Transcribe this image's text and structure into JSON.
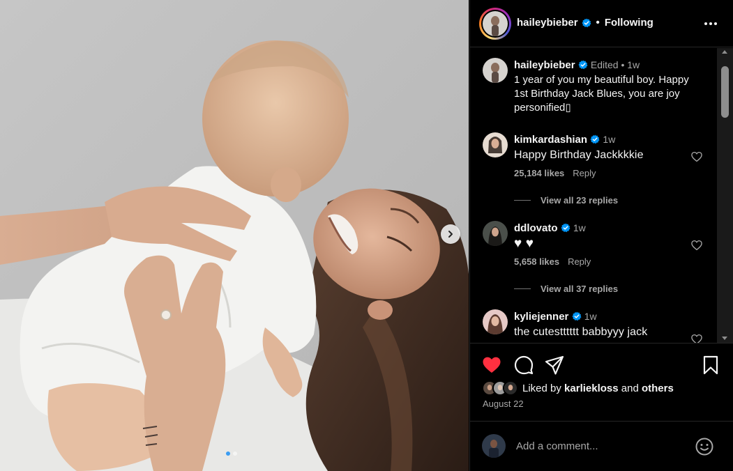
{
  "post": {
    "author": "haileybieber",
    "separator": "•",
    "follow_label": "Following",
    "more_label": "More options"
  },
  "caption": {
    "user": "haileybieber",
    "meta": "Edited •  1w",
    "text": "1 year of you my beautiful boy. Happy 1st Birthday Jack Blues, you are joy personified▯"
  },
  "comments": [
    {
      "user": "kimkardashian",
      "time": "1w",
      "text": "Happy Birthday Jackkkkie",
      "likes": "25,184 likes",
      "reply_label": "Reply",
      "view_replies": "View all 23 replies"
    },
    {
      "user": "ddlovato",
      "time": "1w",
      "text": "♥ ♥",
      "likes": "5,658 likes",
      "reply_label": "Reply",
      "view_replies": "View all 37 replies"
    },
    {
      "user": "kyliejenner",
      "time": "1w",
      "text": "the cutestttttt babbyyy jack"
    }
  ],
  "likes_summary": {
    "prefix": "Liked by",
    "user": "karliekloss",
    "conjunction": "and",
    "others": "others"
  },
  "date": "August 22",
  "composer": {
    "placeholder": "Add a comment..."
  },
  "carousel": {
    "count": 2,
    "active_index": 0
  },
  "icons": {
    "like": "heart-filled-icon",
    "comment": "comment-bubble-icon",
    "share": "paper-plane-icon",
    "save": "bookmark-icon",
    "next": "chevron-right-icon",
    "emoji": "smiley-icon",
    "verified": "verified-badge-icon"
  },
  "colors": {
    "background": "#000000",
    "text": "#f5f5f5",
    "muted": "#a8a8a8",
    "like_red": "#ff3040",
    "verified_blue": "#0095f6"
  }
}
